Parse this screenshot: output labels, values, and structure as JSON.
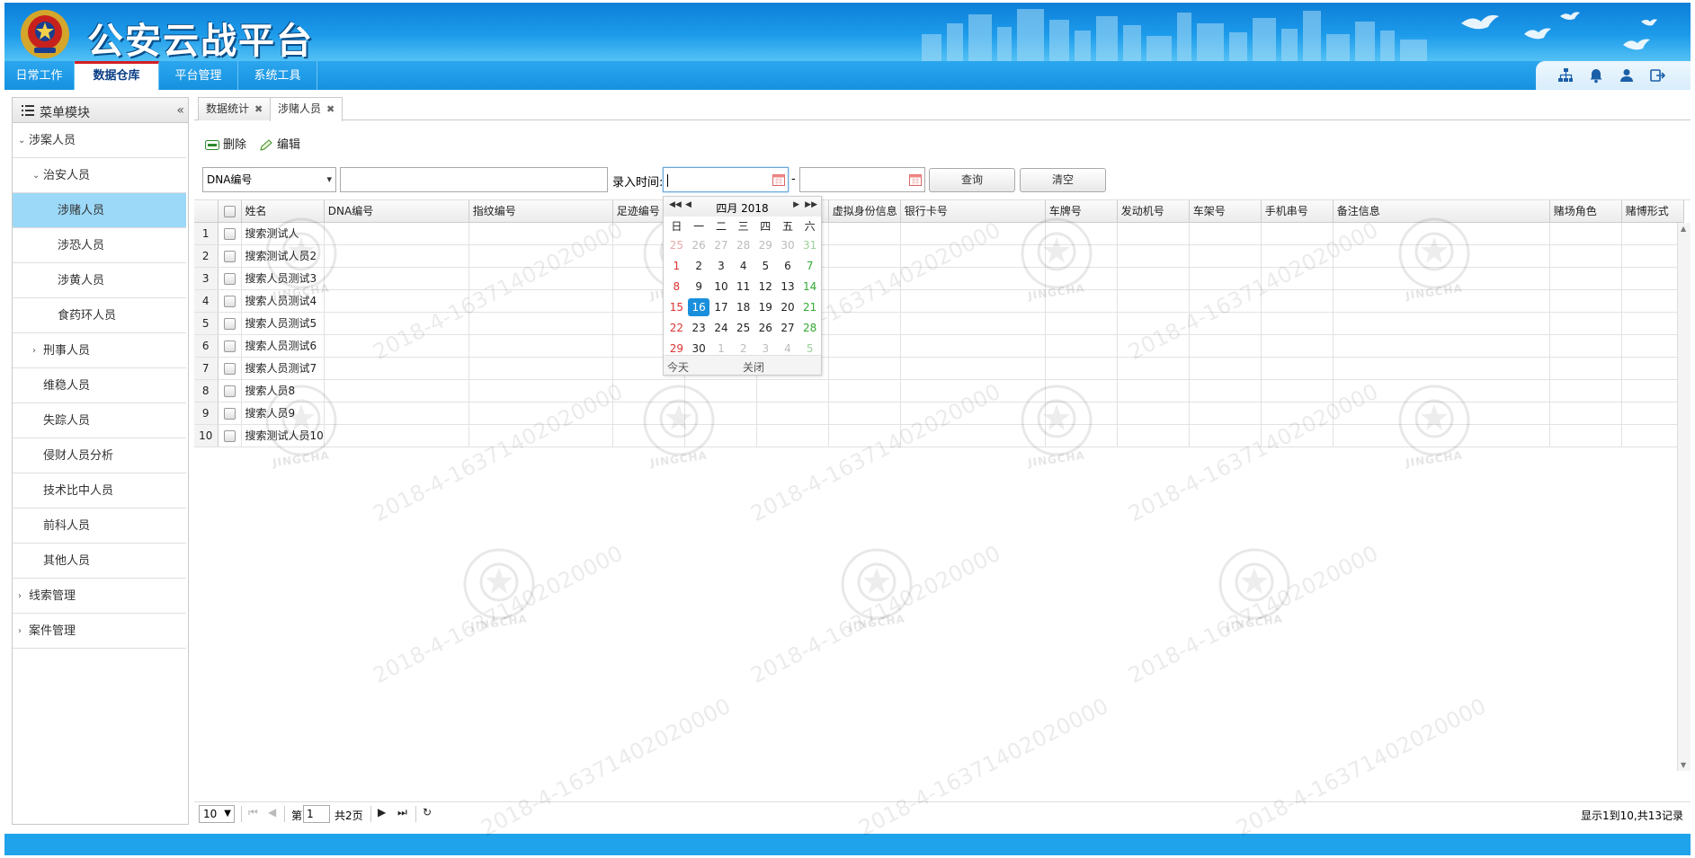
{
  "app": {
    "title": "公安云战平台"
  },
  "nav": {
    "tabs": [
      {
        "label": "日常工作"
      },
      {
        "label": "数据仓库"
      },
      {
        "label": "平台管理"
      },
      {
        "label": "系统工具"
      }
    ],
    "icons": [
      "sitemap-icon",
      "bell-icon",
      "user-icon",
      "logout-icon"
    ]
  },
  "sidebar": {
    "title": "菜单模块",
    "items": [
      {
        "label": "涉案人员"
      },
      {
        "label": "治安人员"
      },
      {
        "label": "涉赌人员"
      },
      {
        "label": "涉恐人员"
      },
      {
        "label": "涉黄人员"
      },
      {
        "label": "食药环人员"
      },
      {
        "label": "刑事人员"
      },
      {
        "label": "维稳人员"
      },
      {
        "label": "失踪人员"
      },
      {
        "label": "侵财人员分析"
      },
      {
        "label": "技术比中人员"
      },
      {
        "label": "前科人员"
      },
      {
        "label": "其他人员"
      },
      {
        "label": "线索管理"
      },
      {
        "label": "案件管理"
      }
    ]
  },
  "page_tabs": [
    {
      "label": "数据统计"
    },
    {
      "label": "涉赌人员"
    }
  ],
  "toolbar": {
    "delete_label": "删除",
    "edit_label": "编辑"
  },
  "search": {
    "field_select": "DNA编号",
    "keyword": "",
    "time_label": "录入时间:",
    "dash": "-",
    "query_label": "查询",
    "clear_label": "清空"
  },
  "grid": {
    "columns": [
      "姓名",
      "DNA编号",
      "指纹编号",
      "足迹编号",
      "",
      "",
      "虚拟身份信息",
      "银行卡号",
      "车牌号",
      "发动机号",
      "车架号",
      "手机串号",
      "备注信息",
      "赌场角色",
      "赌博形式"
    ],
    "rows": [
      {
        "no": "1",
        "name": "搜索测试人"
      },
      {
        "no": "2",
        "name": "搜索测试人员2"
      },
      {
        "no": "3",
        "name": "搜索人员测试3"
      },
      {
        "no": "4",
        "name": "搜索人员测试4"
      },
      {
        "no": "5",
        "name": "搜索人员测试5"
      },
      {
        "no": "6",
        "name": "搜索人员测试6"
      },
      {
        "no": "7",
        "name": "搜索人员测试7"
      },
      {
        "no": "8",
        "name": "搜索人员8"
      },
      {
        "no": "9",
        "name": "搜索人员9"
      },
      {
        "no": "10",
        "name": "搜索测试人员10"
      }
    ]
  },
  "pager": {
    "page_size": "10",
    "page_prefix": "第",
    "page_value": "1",
    "page_total": "共2页",
    "info": "显示1到10,共13记录"
  },
  "calendar": {
    "month_label": "四月 2018",
    "weekdays": [
      "日",
      "一",
      "二",
      "三",
      "四",
      "五",
      "六"
    ],
    "weeks": [
      [
        "25",
        "26",
        "27",
        "28",
        "29",
        "30",
        "31"
      ],
      [
        "1",
        "2",
        "3",
        "4",
        "5",
        "6",
        "7"
      ],
      [
        "8",
        "9",
        "10",
        "11",
        "12",
        "13",
        "14"
      ],
      [
        "15",
        "16",
        "17",
        "18",
        "19",
        "20",
        "21"
      ],
      [
        "22",
        "23",
        "24",
        "25",
        "26",
        "27",
        "28"
      ],
      [
        "29",
        "30",
        "1",
        "2",
        "3",
        "4",
        "5"
      ]
    ],
    "today_label": "今天",
    "close_label": "关闭",
    "selected_day": "16"
  },
  "watermark": {
    "text": "2018-4-16371402020000",
    "emblem_text": "JINGCHA"
  },
  "colors": {
    "header_blue": "#1d9bea",
    "nav_blue": "#1591e0",
    "selected_menu": "#9cd8f7",
    "calendar_today": "#1a8fdc",
    "footer_blue": "#1fa3ea"
  }
}
